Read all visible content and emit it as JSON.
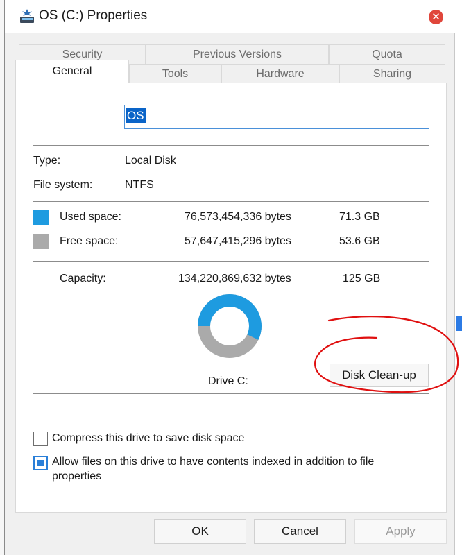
{
  "window": {
    "title": "OS (C:) Properties",
    "close_glyph": "✕",
    "icon": "drive-icon"
  },
  "tabs": {
    "row_back": [
      "Security",
      "Previous Versions",
      "Quota"
    ],
    "row_front": [
      "General",
      "Tools",
      "Hardware",
      "Sharing"
    ],
    "active": "General"
  },
  "general": {
    "name_value": "OS",
    "type_label": "Type:",
    "type_value": "Local Disk",
    "fs_label": "File system:",
    "fs_value": "NTFS",
    "used": {
      "label": "Used space:",
      "bytes": "76,573,454,336 bytes",
      "size": "71.3 GB",
      "color": "#1e9be0"
    },
    "free": {
      "label": "Free space:",
      "bytes": "57,647,415,296 bytes",
      "size": "53.6 GB",
      "color": "#aaaaaa"
    },
    "capacity": {
      "label": "Capacity:",
      "bytes": "134,220,869,632 bytes",
      "size": "125 GB"
    },
    "used_fraction": 0.5705,
    "drive_label": "Drive C:",
    "cleanup_label": "Disk Clean-up",
    "compress_label": "Compress this drive to save disk space",
    "compress_checked": false,
    "index_label_line1": "Allow files on this drive to have contents indexed in addition to file",
    "index_label_line2": "properties",
    "index_checked": true
  },
  "buttons": {
    "ok": "OK",
    "cancel": "Cancel",
    "apply": "Apply"
  },
  "annotation_color": "#e01010"
}
